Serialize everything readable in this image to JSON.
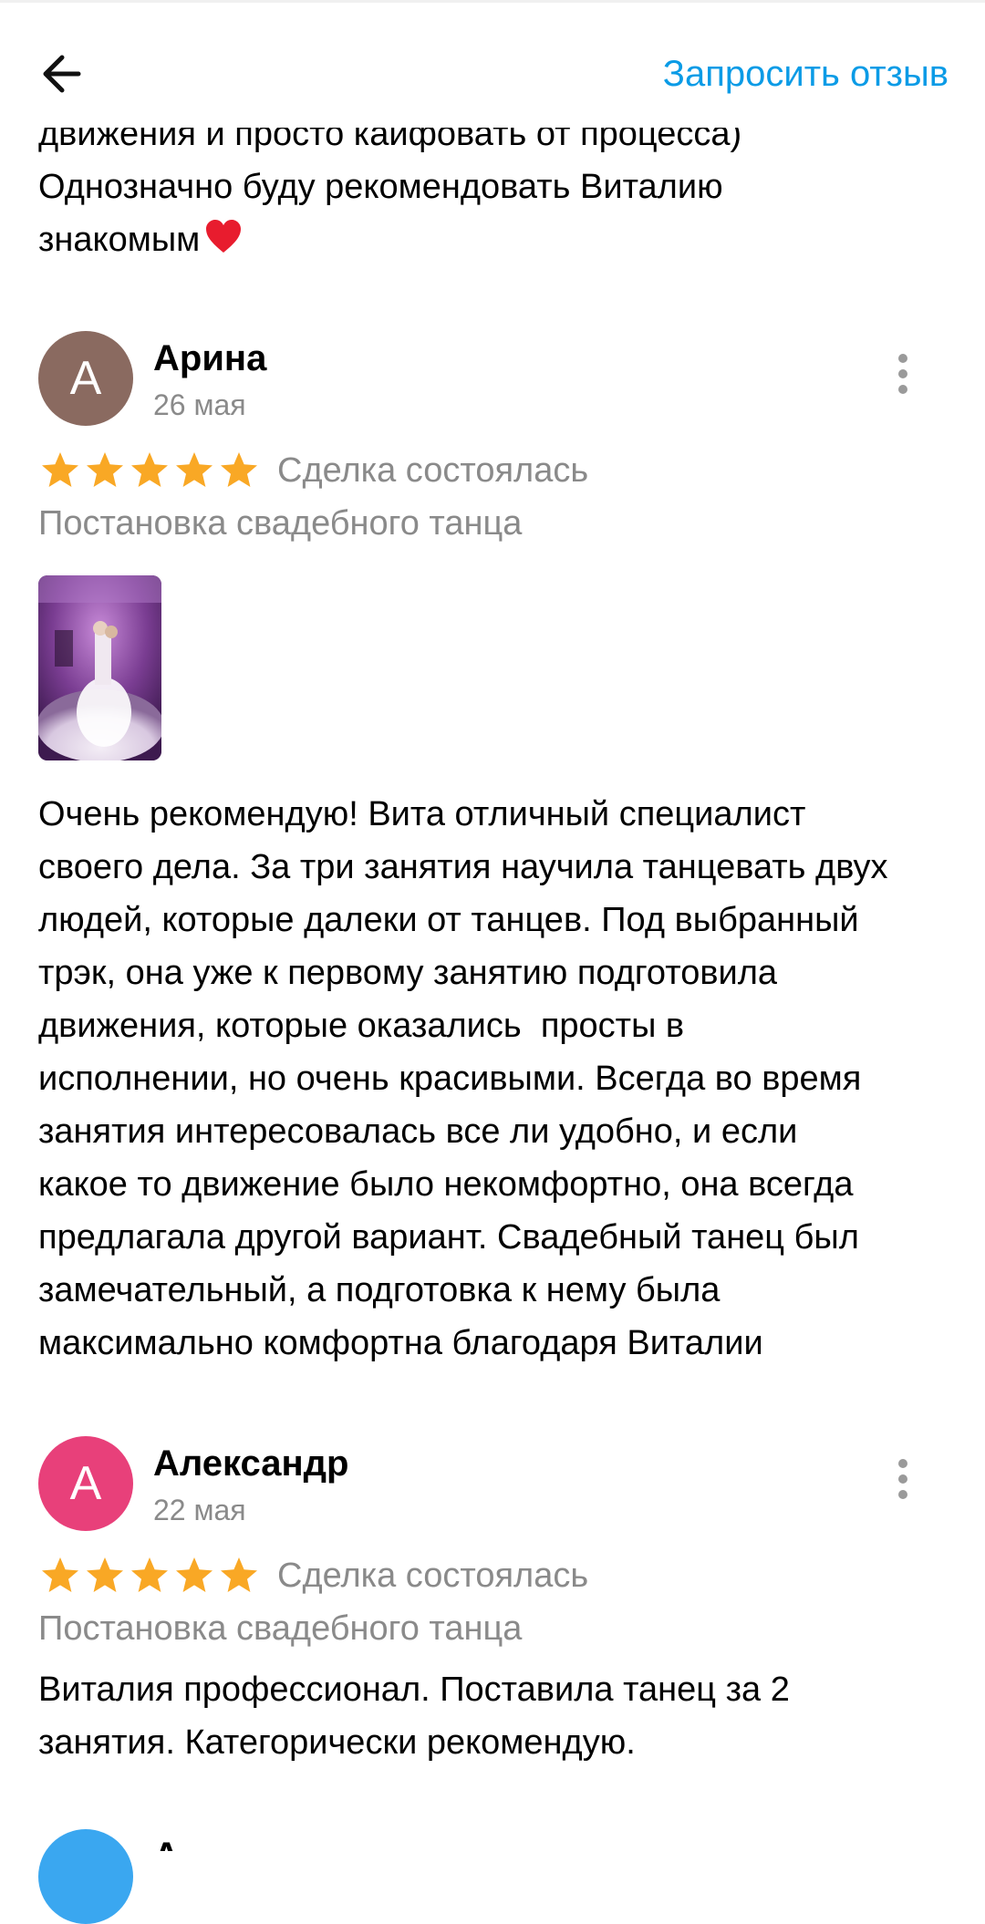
{
  "header": {
    "back_icon": "arrow-left-icon",
    "request_review_label": "Запросить отзыв"
  },
  "prev_review": {
    "cut_line": "движения и просто кайфовать от процесса)",
    "tail_line1": "Однозначно буду рекомендовать Виталию",
    "tail_line2": "знакомым",
    "heart_icon": "red-heart-icon"
  },
  "reviews": [
    {
      "avatar_letter": "А",
      "avatar_color": "#8a6a60",
      "author": "Арина",
      "date": "26 мая",
      "rating": 5,
      "deal_status": "Сделка состоялась",
      "category": "Постановка свадебного танца",
      "has_photo": true,
      "text_lines": [
        "Очень рекомендую! Вита отличный специалист",
        "своего дела. За три занятия научила танцевать двух",
        "людей, которые далеки от танцев. Под выбранный",
        "трэк, она уже к первому занятию подготовила",
        "движения, которые оказались  просты в",
        "исполнении, но очень красивыми. Всегда во время",
        "занятия интересовалась все ли удобно, и если",
        "какое то движение было некомфортно, она всегда",
        "предлагала другой вариант. Свадебный танец был",
        "замечательный, а подготовка к нему была",
        "максимально комфортна благодаря Виталии"
      ]
    },
    {
      "avatar_letter": "А",
      "avatar_color": "#e8407a",
      "author": "Александр",
      "date": "22 мая",
      "rating": 5,
      "deal_status": "Сделка состоялась",
      "category": "Постановка свадебного танца",
      "has_photo": false,
      "text_lines": [
        "Виталия профессионал. Поставила танец за 2",
        "занятия. Категорически рекомендую."
      ]
    }
  ],
  "next_review_peek": {
    "avatar_color": "#3aa7f0",
    "author_first_letter": "А"
  },
  "colors": {
    "accent_link": "#0a9be6",
    "star": "#f9a825",
    "secondary_text": "#8a8a8a"
  }
}
